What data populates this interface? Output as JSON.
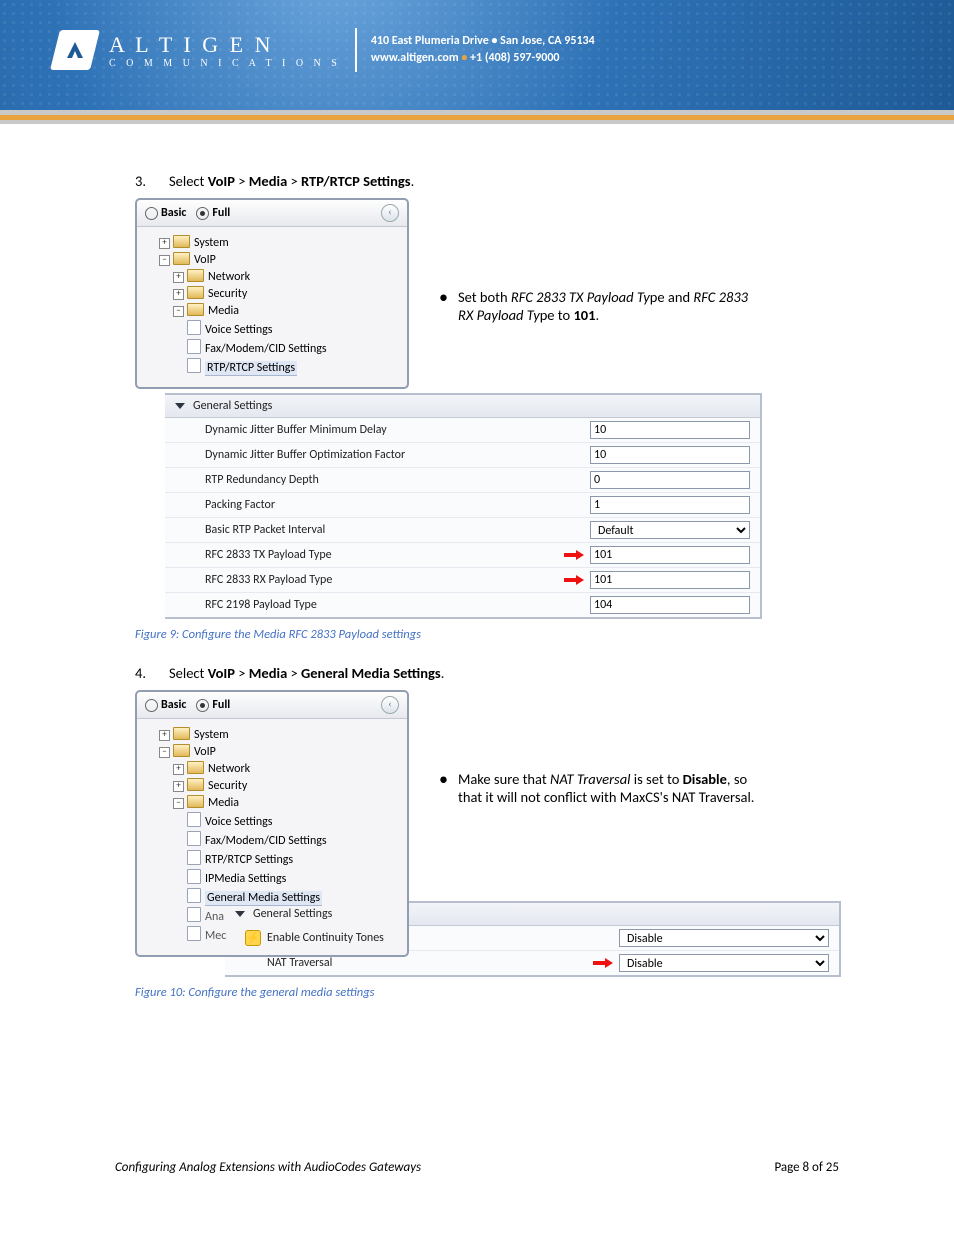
{
  "header": {
    "company_line1": "A L T I G E N",
    "company_line2": "C O M M U N I C A T I O N S",
    "address_line1": "410 East Plumeria Drive • San Jose, CA 95134",
    "address_line2a": "www.altigen.com",
    "address_line2b": "+1 (408) 597-9000"
  },
  "step3": {
    "number": "3.",
    "prefix": "Select ",
    "voip": "VoIP",
    "sep": " > ",
    "media": "Media",
    "rtp": "RTP/RTCP Settings",
    "suffix": ".",
    "bullet_pre": "Set both ",
    "bullet_tx": "RFC 2833 TX Payload Ty",
    "bullet_mid": "pe and ",
    "bullet_rx": "RFC 2833 RX Payload Ty",
    "bullet_post": "pe to ",
    "bullet_val": "101",
    "bullet_end": "."
  },
  "step4": {
    "number": "4.",
    "prefix": "Select ",
    "voip": "VoIP",
    "sep": " > ",
    "media": "Media",
    "gms": "General Media Settings",
    "suffix": ".",
    "bullet_pre": "Make sure that ",
    "bullet_nat": "NAT Traversal",
    "bullet_mid": " is set to ",
    "bullet_dis": "Disable",
    "bullet_post": ", so that it will not conflict with MaxCS's NAT Traversal."
  },
  "nav": {
    "basic": "Basic",
    "full": "Full",
    "system": "System",
    "voip": "VoIP",
    "network": "Network",
    "security": "Security",
    "media": "Media",
    "voice": "Voice Settings",
    "fax": "Fax/Modem/CID Settings",
    "rtp": "RTP/RTCP Settings",
    "ipmedia": "IPMedia Settings",
    "gms": "General Media Settings",
    "ana": "Ana",
    "mec": "Mec"
  },
  "table1": {
    "header": "General Settings",
    "r1": "Dynamic Jitter Buffer Minimum Delay",
    "v1": "10",
    "r2": "Dynamic Jitter Buffer Optimization Factor",
    "v2": "10",
    "r3": "RTP Redundancy Depth",
    "v3": "0",
    "r4": "Packing Factor",
    "v4": "1",
    "r5": "Basic RTP Packet Interval",
    "v5": "Default",
    "r6": "RFC 2833 TX Payload Type",
    "v6": "101",
    "r7": "RFC 2833 RX Payload Type",
    "v7": "101",
    "r8": "RFC 2198 Payload Type",
    "v8": "104"
  },
  "table2": {
    "header": "General Settings",
    "r1": "Enable Continuity Tones",
    "v1": "Disable",
    "r2": "NAT Traversal",
    "v2": "Disable"
  },
  "captions": {
    "fig9": "Figure 9: Configure the Media RFC 2833 Payload settings",
    "fig10": "Figure 10: Configure the general media settings"
  },
  "footer": {
    "title": "Configuring Analog Extensions with AudioCodes Gateways",
    "page": "Page 8 of 25"
  }
}
